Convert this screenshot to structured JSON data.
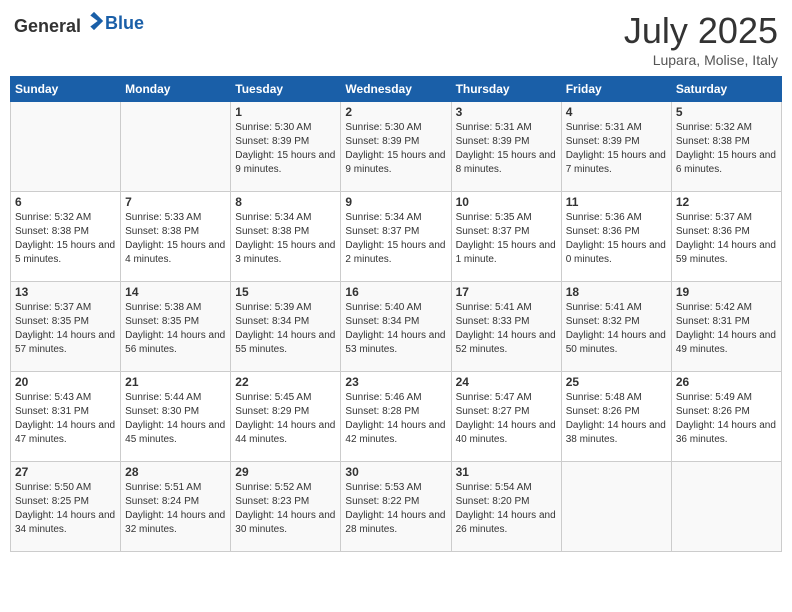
{
  "logo": {
    "text_general": "General",
    "text_blue": "Blue"
  },
  "title": {
    "month_year": "July 2025",
    "location": "Lupara, Molise, Italy"
  },
  "weekdays": [
    "Sunday",
    "Monday",
    "Tuesday",
    "Wednesday",
    "Thursday",
    "Friday",
    "Saturday"
  ],
  "weeks": [
    [
      {
        "day": "",
        "sunrise": "",
        "sunset": "",
        "daylight": ""
      },
      {
        "day": "",
        "sunrise": "",
        "sunset": "",
        "daylight": ""
      },
      {
        "day": "1",
        "sunrise": "Sunrise: 5:30 AM",
        "sunset": "Sunset: 8:39 PM",
        "daylight": "Daylight: 15 hours and 9 minutes."
      },
      {
        "day": "2",
        "sunrise": "Sunrise: 5:30 AM",
        "sunset": "Sunset: 8:39 PM",
        "daylight": "Daylight: 15 hours and 9 minutes."
      },
      {
        "day": "3",
        "sunrise": "Sunrise: 5:31 AM",
        "sunset": "Sunset: 8:39 PM",
        "daylight": "Daylight: 15 hours and 8 minutes."
      },
      {
        "day": "4",
        "sunrise": "Sunrise: 5:31 AM",
        "sunset": "Sunset: 8:39 PM",
        "daylight": "Daylight: 15 hours and 7 minutes."
      },
      {
        "day": "5",
        "sunrise": "Sunrise: 5:32 AM",
        "sunset": "Sunset: 8:38 PM",
        "daylight": "Daylight: 15 hours and 6 minutes."
      }
    ],
    [
      {
        "day": "6",
        "sunrise": "Sunrise: 5:32 AM",
        "sunset": "Sunset: 8:38 PM",
        "daylight": "Daylight: 15 hours and 5 minutes."
      },
      {
        "day": "7",
        "sunrise": "Sunrise: 5:33 AM",
        "sunset": "Sunset: 8:38 PM",
        "daylight": "Daylight: 15 hours and 4 minutes."
      },
      {
        "day": "8",
        "sunrise": "Sunrise: 5:34 AM",
        "sunset": "Sunset: 8:38 PM",
        "daylight": "Daylight: 15 hours and 3 minutes."
      },
      {
        "day": "9",
        "sunrise": "Sunrise: 5:34 AM",
        "sunset": "Sunset: 8:37 PM",
        "daylight": "Daylight: 15 hours and 2 minutes."
      },
      {
        "day": "10",
        "sunrise": "Sunrise: 5:35 AM",
        "sunset": "Sunset: 8:37 PM",
        "daylight": "Daylight: 15 hours and 1 minute."
      },
      {
        "day": "11",
        "sunrise": "Sunrise: 5:36 AM",
        "sunset": "Sunset: 8:36 PM",
        "daylight": "Daylight: 15 hours and 0 minutes."
      },
      {
        "day": "12",
        "sunrise": "Sunrise: 5:37 AM",
        "sunset": "Sunset: 8:36 PM",
        "daylight": "Daylight: 14 hours and 59 minutes."
      }
    ],
    [
      {
        "day": "13",
        "sunrise": "Sunrise: 5:37 AM",
        "sunset": "Sunset: 8:35 PM",
        "daylight": "Daylight: 14 hours and 57 minutes."
      },
      {
        "day": "14",
        "sunrise": "Sunrise: 5:38 AM",
        "sunset": "Sunset: 8:35 PM",
        "daylight": "Daylight: 14 hours and 56 minutes."
      },
      {
        "day": "15",
        "sunrise": "Sunrise: 5:39 AM",
        "sunset": "Sunset: 8:34 PM",
        "daylight": "Daylight: 14 hours and 55 minutes."
      },
      {
        "day": "16",
        "sunrise": "Sunrise: 5:40 AM",
        "sunset": "Sunset: 8:34 PM",
        "daylight": "Daylight: 14 hours and 53 minutes."
      },
      {
        "day": "17",
        "sunrise": "Sunrise: 5:41 AM",
        "sunset": "Sunset: 8:33 PM",
        "daylight": "Daylight: 14 hours and 52 minutes."
      },
      {
        "day": "18",
        "sunrise": "Sunrise: 5:41 AM",
        "sunset": "Sunset: 8:32 PM",
        "daylight": "Daylight: 14 hours and 50 minutes."
      },
      {
        "day": "19",
        "sunrise": "Sunrise: 5:42 AM",
        "sunset": "Sunset: 8:31 PM",
        "daylight": "Daylight: 14 hours and 49 minutes."
      }
    ],
    [
      {
        "day": "20",
        "sunrise": "Sunrise: 5:43 AM",
        "sunset": "Sunset: 8:31 PM",
        "daylight": "Daylight: 14 hours and 47 minutes."
      },
      {
        "day": "21",
        "sunrise": "Sunrise: 5:44 AM",
        "sunset": "Sunset: 8:30 PM",
        "daylight": "Daylight: 14 hours and 45 minutes."
      },
      {
        "day": "22",
        "sunrise": "Sunrise: 5:45 AM",
        "sunset": "Sunset: 8:29 PM",
        "daylight": "Daylight: 14 hours and 44 minutes."
      },
      {
        "day": "23",
        "sunrise": "Sunrise: 5:46 AM",
        "sunset": "Sunset: 8:28 PM",
        "daylight": "Daylight: 14 hours and 42 minutes."
      },
      {
        "day": "24",
        "sunrise": "Sunrise: 5:47 AM",
        "sunset": "Sunset: 8:27 PM",
        "daylight": "Daylight: 14 hours and 40 minutes."
      },
      {
        "day": "25",
        "sunrise": "Sunrise: 5:48 AM",
        "sunset": "Sunset: 8:26 PM",
        "daylight": "Daylight: 14 hours and 38 minutes."
      },
      {
        "day": "26",
        "sunrise": "Sunrise: 5:49 AM",
        "sunset": "Sunset: 8:26 PM",
        "daylight": "Daylight: 14 hours and 36 minutes."
      }
    ],
    [
      {
        "day": "27",
        "sunrise": "Sunrise: 5:50 AM",
        "sunset": "Sunset: 8:25 PM",
        "daylight": "Daylight: 14 hours and 34 minutes."
      },
      {
        "day": "28",
        "sunrise": "Sunrise: 5:51 AM",
        "sunset": "Sunset: 8:24 PM",
        "daylight": "Daylight: 14 hours and 32 minutes."
      },
      {
        "day": "29",
        "sunrise": "Sunrise: 5:52 AM",
        "sunset": "Sunset: 8:23 PM",
        "daylight": "Daylight: 14 hours and 30 minutes."
      },
      {
        "day": "30",
        "sunrise": "Sunrise: 5:53 AM",
        "sunset": "Sunset: 8:22 PM",
        "daylight": "Daylight: 14 hours and 28 minutes."
      },
      {
        "day": "31",
        "sunrise": "Sunrise: 5:54 AM",
        "sunset": "Sunset: 8:20 PM",
        "daylight": "Daylight: 14 hours and 26 minutes."
      },
      {
        "day": "",
        "sunrise": "",
        "sunset": "",
        "daylight": ""
      },
      {
        "day": "",
        "sunrise": "",
        "sunset": "",
        "daylight": ""
      }
    ]
  ]
}
